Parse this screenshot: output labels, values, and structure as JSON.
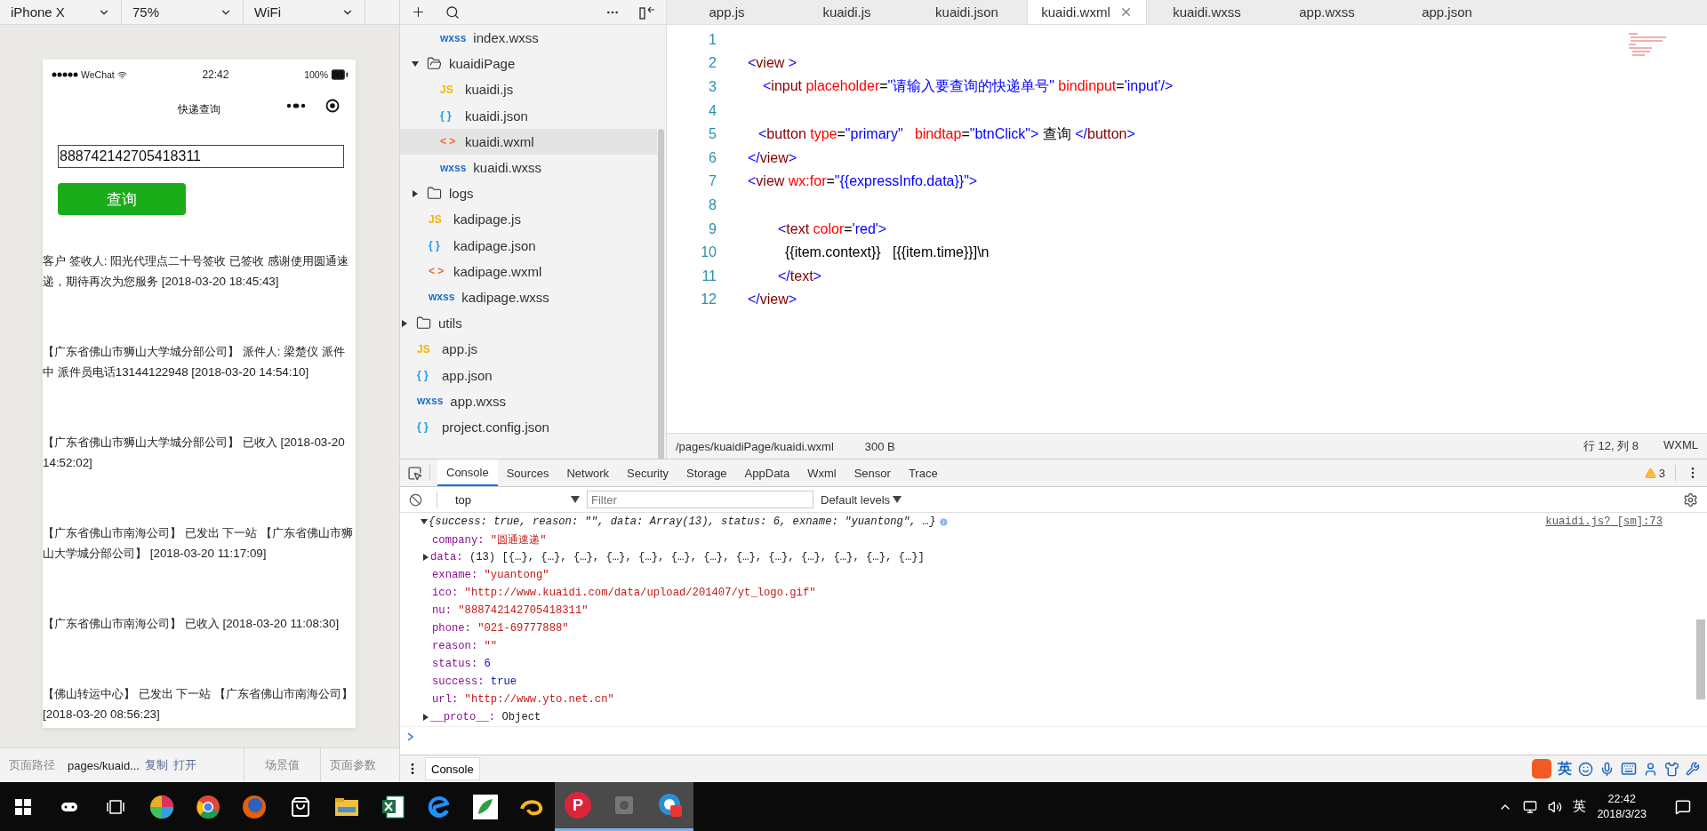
{
  "simulator": {
    "device": "iPhone X",
    "zoom": "75%",
    "network": "WiFi",
    "phone": {
      "carrier": "WeChat",
      "time": "22:42",
      "battery": "100%",
      "title": "快递查询",
      "input_value": "888742142705418311",
      "button": "查询",
      "entries": [
        "客户 签收人: 阳光代理点二十号签收 已签收 感谢使用圆通速递，期待再次为您服务 [2018-03-20 18:45:43]",
        "【广东省佛山市狮山大学城分部公司】 派件人: 梁楚仪 派件中 派件员电话13144122948 [2018-03-20 14:54:10]",
        "【广东省佛山市狮山大学城分部公司】 已收入 [2018-03-20 14:52:02]",
        "【广东省佛山市南海公司】 已发出 下一站 【广东省佛山市狮山大学城分部公司】 [2018-03-20 11:17:09]",
        "【广东省佛山市南海公司】 已收入 [2018-03-20 11:08:30]",
        "【佛山转运中心】 已发出 下一站 【广东省佛山市南海公司】 [2018-03-20 08:56:23]"
      ]
    },
    "footer": {
      "path_label": "页面路径",
      "path": "pages/kuaid...",
      "copy": "复制",
      "open": "打开",
      "scene": "场景值",
      "params": "页面参数"
    }
  },
  "file_tree": {
    "items": [
      {
        "children": [
          {
            "children": [
              {
                "name": "index.wxss",
                "kind": "wxss",
                "badge": "wxss",
                "selected": false
              }
            ]
          },
          {
            "name": "kuaidiPage",
            "kind": "folder",
            "expanded": true,
            "selected": false,
            "children": [
              {
                "name": "kuaidi.js",
                "kind": "js",
                "badge": "JS",
                "selected": false
              },
              {
                "name": "kuaidi.json",
                "kind": "json",
                "badge": "{ }",
                "selected": false
              },
              {
                "name": "kuaidi.wxml",
                "kind": "wxml",
                "badge": "< >",
                "selected": true
              },
              {
                "name": "kuaidi.wxss",
                "kind": "wxss",
                "badge": "wxss",
                "selected": false
              }
            ]
          },
          {
            "name": "logs",
            "kind": "folder",
            "expanded": false,
            "selected": false
          },
          {
            "name": "kadipage.js",
            "kind": "js",
            "badge": "JS",
            "selected": false
          },
          {
            "name": "kadipage.json",
            "kind": "json",
            "badge": "{ }",
            "selected": false
          },
          {
            "name": "kadipage.wxml",
            "kind": "wxml",
            "badge": "< >",
            "selected": false
          },
          {
            "name": "kadipage.wxss",
            "kind": "wxss",
            "badge": "wxss",
            "selected": false
          }
        ]
      },
      {
        "name": "utils",
        "kind": "folder",
        "expanded": false,
        "selected": false
      },
      {
        "name": "app.js",
        "kind": "js",
        "badge": "JS",
        "selected": false
      },
      {
        "name": "app.json",
        "kind": "json",
        "badge": "{ }",
        "selected": false
      },
      {
        "name": "app.wxss",
        "kind": "wxss",
        "badge": "wxss",
        "selected": false
      },
      {
        "name": "project.config.json",
        "kind": "json",
        "badge": "{ }",
        "selected": false
      }
    ]
  },
  "editor": {
    "tabs": [
      {
        "label": "app.js",
        "selected": false
      },
      {
        "label": "kuaidi.js",
        "selected": false
      },
      {
        "label": "kuaidi.json",
        "selected": false
      },
      {
        "label": "kuaidi.wxml",
        "selected": true
      },
      {
        "label": "kuaidi.wxss",
        "selected": false
      },
      {
        "label": "app.wxss",
        "selected": false
      },
      {
        "label": "app.json",
        "selected": false
      }
    ],
    "lines": [
      {
        "number": "1"
      },
      {
        "number": "2",
        "kind": "top",
        "tokens": [
          {
            "kind": "bracket",
            "text": "<"
          },
          {
            "kind": "tag",
            "text": "view"
          },
          {
            "kind": "bracket",
            "text": " >"
          }
        ]
      },
      {
        "number": "3",
        "kind": "child",
        "tokens": [
          {
            "kind": "bracket",
            "text": "<"
          },
          {
            "kind": "tag",
            "text": "input"
          },
          {
            "kind": "attr",
            "text": " placeholder"
          },
          {
            "kind": "punct",
            "text": "="
          },
          {
            "kind": "string",
            "text": "\"请输入要查询的快递单号\""
          },
          {
            "kind": "attr",
            "text": " bindinput"
          },
          {
            "kind": "punct",
            "text": "="
          },
          {
            "kind": "string",
            "text": "'input'"
          },
          {
            "kind": "bracket",
            "text": "/>"
          }
        ]
      },
      {
        "number": "4"
      },
      {
        "number": "5",
        "kind": "sibling",
        "tokens": [
          {
            "kind": "bracket",
            "text": "<"
          },
          {
            "kind": "tag",
            "text": "button"
          },
          {
            "kind": "attr",
            "text": " type"
          },
          {
            "kind": "punct",
            "text": "="
          },
          {
            "kind": "string",
            "text": "\"primary\""
          },
          {
            "kind": "attr",
            "text": "   bindtap"
          },
          {
            "kind": "punct",
            "text": "="
          },
          {
            "kind": "string",
            "text": "\"btnClick\""
          },
          {
            "kind": "bracket",
            "text": ">"
          },
          {
            "kind": "text",
            "text": " 查询 "
          },
          {
            "kind": "bracket",
            "text": "</"
          },
          {
            "kind": "tag",
            "text": "button"
          },
          {
            "kind": "bracket",
            "text": ">"
          }
        ]
      },
      {
        "number": "6",
        "kind": "top",
        "tokens": [
          {
            "kind": "bracket",
            "text": "</"
          },
          {
            "kind": "tag",
            "text": "view"
          },
          {
            "kind": "bracket",
            "text": ">"
          }
        ]
      },
      {
        "number": "7",
        "kind": "top",
        "tokens": [
          {
            "kind": "bracket",
            "text": "<"
          },
          {
            "kind": "tag",
            "text": "view"
          },
          {
            "kind": "attr",
            "text": " wx:for"
          },
          {
            "kind": "punct",
            "text": "="
          },
          {
            "kind": "string",
            "text": "\"{{expressInfo.data}}\""
          },
          {
            "kind": "bracket",
            "text": ">"
          }
        ]
      },
      {
        "number": "8"
      },
      {
        "number": "9",
        "kind": "nested",
        "tokens": [
          {
            "kind": "bracket",
            "text": "<"
          },
          {
            "kind": "tag",
            "text": "text"
          },
          {
            "kind": "attr",
            "text": " color"
          },
          {
            "kind": "punct",
            "text": "="
          },
          {
            "kind": "string",
            "text": "'red'"
          },
          {
            "kind": "bracket",
            "text": ">"
          }
        ]
      },
      {
        "number": "10",
        "kind": "content",
        "tokens": [
          {
            "kind": "text",
            "text": "{{item.context}}   [{{item.time}}]\\n"
          }
        ]
      },
      {
        "number": "11",
        "kind": "nested",
        "tokens": [
          {
            "kind": "bracket",
            "text": "</"
          },
          {
            "kind": "tag",
            "text": "text"
          },
          {
            "kind": "bracket",
            "text": ">"
          }
        ]
      },
      {
        "number": "12",
        "kind": "top",
        "tokens": [
          {
            "kind": "bracket",
            "text": "</"
          },
          {
            "kind": "tag",
            "text": "view"
          },
          {
            "kind": "bracket",
            "text": ">"
          }
        ]
      }
    ],
    "status": {
      "path": "/pages/kuaidiPage/kuaidi.wxml",
      "size": "300 B",
      "position": "行 12, 列 8",
      "language": "WXML"
    }
  },
  "devtools": {
    "tabs": [
      {
        "label": "Console",
        "selected": true
      },
      {
        "label": "Sources",
        "selected": false
      },
      {
        "label": "Network",
        "selected": false
      },
      {
        "label": "Security",
        "selected": false
      },
      {
        "label": "Storage",
        "selected": false
      },
      {
        "label": "AppData",
        "selected": false
      },
      {
        "label": "Wxml",
        "selected": false
      },
      {
        "label": "Sensor",
        "selected": false
      },
      {
        "label": "Trace",
        "selected": false
      }
    ],
    "warnings": "3",
    "context": "top",
    "filter_placeholder": "Filter",
    "levels": "Default levels",
    "summary": "{success: true, reason: \"\", data: Array(13), status: 6, exname: \"yuantong\", …}",
    "source": "kuaidi.js? [sm]:73",
    "properties": [
      {
        "key": "company:",
        "value": "\"圆通速递\"",
        "kind": "string"
      },
      {
        "key": "data:",
        "value": "(13) [{…}, {…}, {…}, {…}, {…}, {…}, {…}, {…}, {…}, {…}, {…}, {…}, {…}]",
        "kind": "array",
        "expanded": false
      },
      {
        "key": "exname:",
        "value": "\"yuantong\"",
        "kind": "string"
      },
      {
        "key": "ico:",
        "value": "\"http://www.kuaidi.com/data/upload/201407/yt_logo.gif\"",
        "kind": "string"
      },
      {
        "key": "nu:",
        "value": "\"888742142705418311\"",
        "kind": "string"
      },
      {
        "key": "phone:",
        "value": "\"021-69777888\"",
        "kind": "string"
      },
      {
        "key": "reason:",
        "value": "\"\"",
        "kind": "string"
      },
      {
        "key": "status:",
        "value": "6",
        "kind": "number"
      },
      {
        "key": "success:",
        "value": "true",
        "kind": "boolean"
      },
      {
        "key": "url:",
        "value": "\"http://www.yto.net.cn\"",
        "kind": "string"
      },
      {
        "key": "__proto__:",
        "value": "Object",
        "kind": "object",
        "expanded": false
      }
    ],
    "drawer_tab": "Console"
  },
  "ime_bar": {
    "label": "英"
  },
  "taskbar": {
    "apps": [
      {
        "kind": "controller",
        "active": false
      },
      {
        "kind": "taskview",
        "active": false
      },
      {
        "kind": "wheel",
        "active": false
      },
      {
        "kind": "globe",
        "active": false
      },
      {
        "kind": "fox",
        "active": false
      },
      {
        "kind": "bag",
        "active": false
      },
      {
        "kind": "folder",
        "active": false
      },
      {
        "kind": "sheet",
        "active": false
      },
      {
        "kind": "edge",
        "active": false
      },
      {
        "kind": "leaf",
        "active": false
      },
      {
        "kind": "swirl",
        "active": false
      },
      {
        "kind": "letter",
        "letter": "P",
        "active": true
      },
      {
        "kind": "square",
        "active": true
      },
      {
        "kind": "recorder",
        "active": true
      }
    ],
    "ime": "英",
    "time": "22:42",
    "date": "2018/3/23"
  }
}
